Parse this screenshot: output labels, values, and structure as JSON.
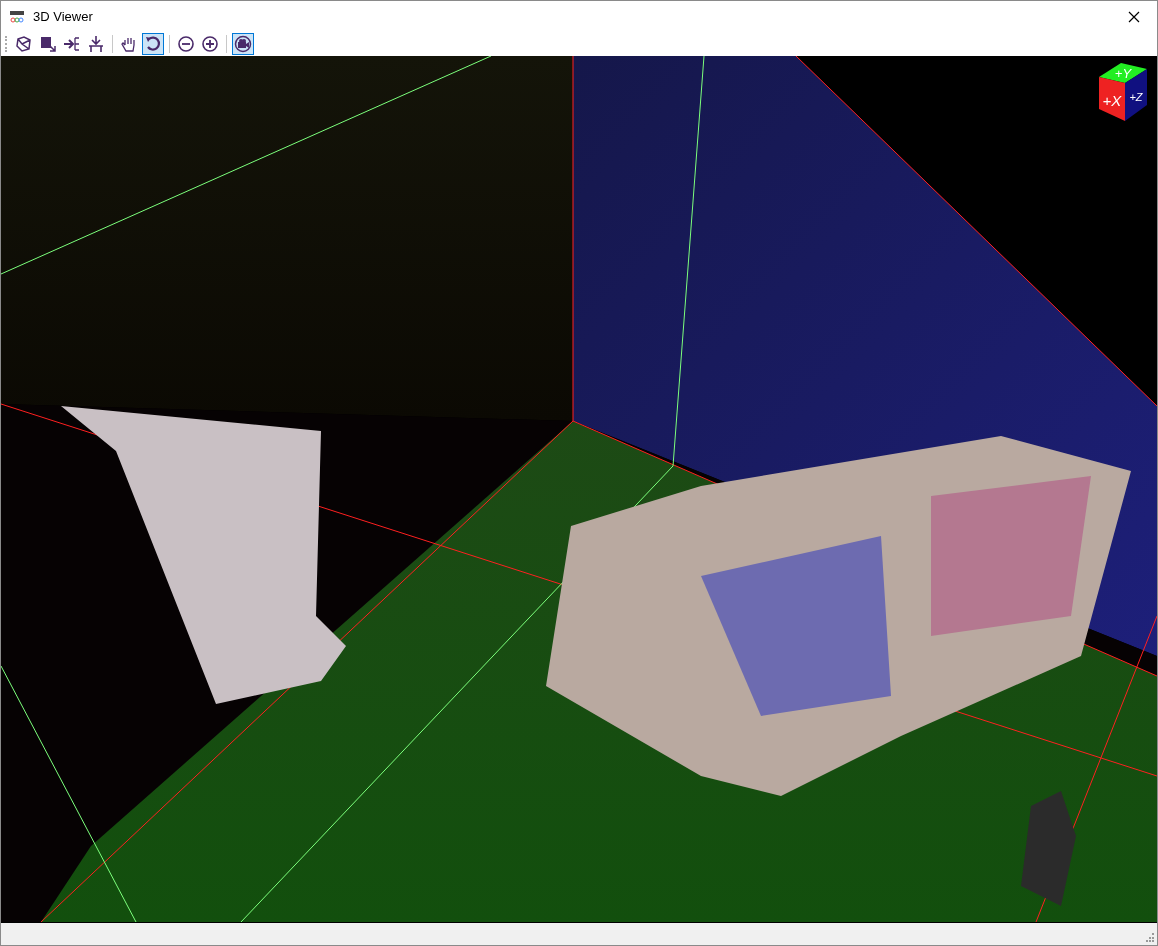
{
  "window": {
    "title": "3D Viewer"
  },
  "toolbar": [
    {
      "tools": [
        {
          "kind": "box",
          "selected": false
        },
        {
          "kind": "select",
          "selected": false
        },
        {
          "kind": "fit",
          "selected": false
        },
        {
          "kind": "drop",
          "selected": false
        }
      ]
    },
    {
      "tools": [
        {
          "kind": "hand",
          "selected": false
        },
        {
          "kind": "rotate",
          "selected": true
        }
      ]
    },
    {
      "tools": [
        {
          "kind": "zoomout",
          "selected": false
        },
        {
          "kind": "zoomin",
          "selected": false
        }
      ]
    },
    {
      "tools": [
        {
          "kind": "camera",
          "selected": true
        }
      ]
    }
  ],
  "viewport": {
    "axis_cube": {
      "top": "+Y",
      "front": "+X",
      "side": "+Z"
    }
  }
}
